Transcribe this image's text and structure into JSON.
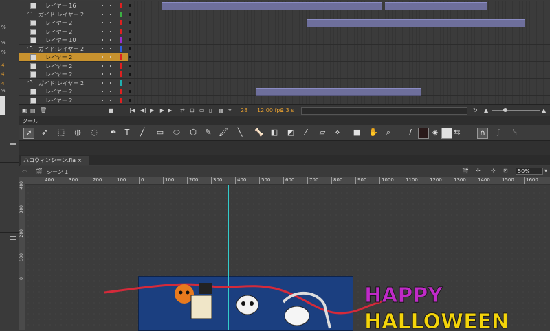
{
  "left_panel": {
    "values": [
      "4",
      "4",
      "4"
    ],
    "percents": [
      "%",
      "%",
      "%",
      "%"
    ]
  },
  "timeline": {
    "layers": [
      {
        "name": "レイヤー 16",
        "type": "layer",
        "color": "#e02020"
      },
      {
        "name": "ガイド:レイヤー 2",
        "type": "guide",
        "color": "#3cb043"
      },
      {
        "name": "レイヤー 2",
        "type": "layer",
        "color": "#e02020"
      },
      {
        "name": "レイヤー 2",
        "type": "layer",
        "color": "#e02020"
      },
      {
        "name": "レイヤー 10",
        "type": "layer",
        "color": "#9b30d0"
      },
      {
        "name": "ガイド:レイヤー 2",
        "type": "guide",
        "color": "#3060e0"
      },
      {
        "name": "レイヤー 2",
        "type": "layer",
        "color": "#e02020",
        "selected": true
      },
      {
        "name": "レイヤー 2",
        "type": "layer",
        "color": "#e02020"
      },
      {
        "name": "レイヤー 2",
        "type": "layer",
        "color": "#e02020"
      },
      {
        "name": "ガイド:レイヤー 2",
        "type": "guide",
        "color": "#20b0b0"
      },
      {
        "name": "レイヤー 2",
        "type": "layer",
        "color": "#e02020"
      },
      {
        "name": "レイヤー 2",
        "type": "layer",
        "color": "#e02020"
      }
    ],
    "frame_number": "28",
    "fps": "12.00 fps",
    "time": "2.3 s"
  },
  "tools_panel": {
    "title": "ツール"
  },
  "document": {
    "tab": "ハロウィンシーン.fla ×",
    "scene": "シーン 1",
    "zoom": "50%"
  },
  "ruler": {
    "top": [
      "400",
      "300",
      "200",
      "100",
      "0",
      "100",
      "200",
      "300",
      "400",
      "500",
      "600",
      "700",
      "800",
      "900",
      "1000",
      "1100",
      "1200",
      "1300",
      "1400",
      "1500",
      "1600"
    ],
    "left": [
      "400",
      "300",
      "200",
      "100",
      "0"
    ]
  },
  "artwork": {
    "title_text": "HAPPY HALLOWEEN"
  }
}
